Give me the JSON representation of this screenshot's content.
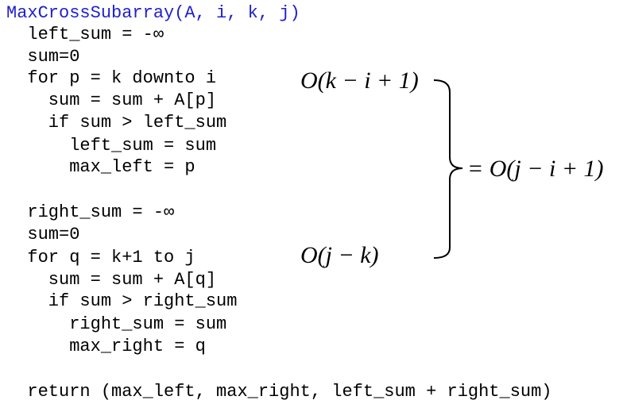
{
  "code": {
    "signature": "MaxCrossSubarray(A, i, k, j)",
    "lines": [
      "  left_sum = -∞",
      "  sum=0",
      "  for p = k downto i",
      "    sum = sum + A[p]",
      "    if sum > left_sum",
      "      left_sum = sum",
      "      max_left = p",
      "",
      "  right_sum = -∞",
      "  sum=0",
      "  for q = k+1 to j",
      "    sum = sum + A[q]",
      "    if sum > right_sum",
      "      right_sum = sum",
      "      max_right = q",
      "",
      "  return (max_left, max_right, left_sum + right_sum)"
    ]
  },
  "annotations": {
    "left_loop_cost": "O(k − i + 1)",
    "right_loop_cost": "O(j − k)",
    "total_cost": "= O(j − i + 1)"
  },
  "colors": {
    "signature": "#1f1fd0",
    "text": "#000000"
  }
}
